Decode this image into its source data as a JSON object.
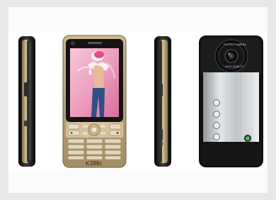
{
  "image": {
    "subject": "K388c phone product shots",
    "views": [
      "left-side",
      "front",
      "right-side",
      "back"
    ]
  },
  "phone": {
    "model_label": "K388c",
    "camera_ring_top": "DIGITAL CAMERA",
    "camera_ring_bottom": "HIGH QUALITY"
  },
  "colors": {
    "gold_body": "#b8a27a",
    "black_trim": "#1a1a1a",
    "silver_panel": "#c9cdd1",
    "screen_pink": "#f0a9c3"
  }
}
